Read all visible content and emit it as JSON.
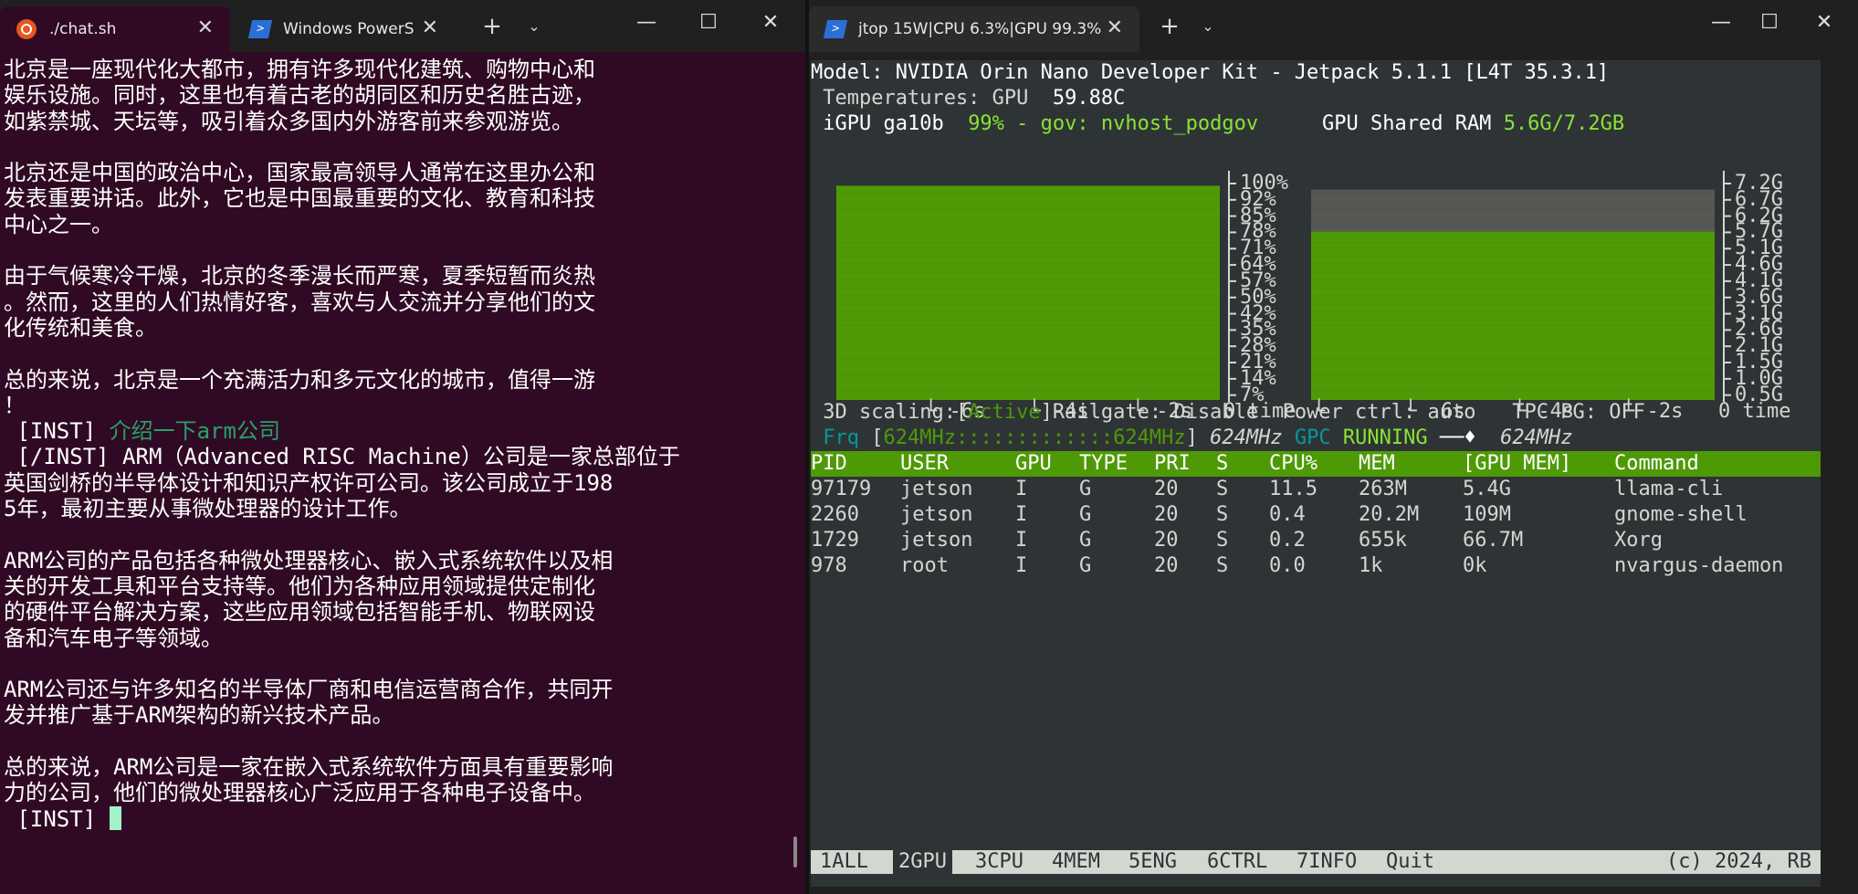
{
  "left_window": {
    "tabs": [
      {
        "label": "./chat.sh",
        "icon": "ubuntu-icon",
        "active": true
      },
      {
        "label": "Windows PowerS",
        "icon": "powershell-icon",
        "active": false
      }
    ],
    "new_tab": "+",
    "dropdown": "⌄",
    "controls": {
      "minimize": "—",
      "maximize": "☐",
      "close": "✕"
    },
    "terminal_lines": [
      {
        "text": "北京是一座现代化大都市，拥有许多现代化建筑、购物中心和"
      },
      {
        "text": "娱乐设施。同时，这里也有着古老的胡同区和历史名胜古迹，"
      },
      {
        "text": "如紫禁城、天坛等，吸引着众多国内外游客前来参观游览。"
      },
      {
        "text": ""
      },
      {
        "text": "北京还是中国的政治中心，国家最高领导人通常在这里办公和"
      },
      {
        "text": "发表重要讲话。此外，它也是中国最重要的文化、教育和科技"
      },
      {
        "text": "中心之一。"
      },
      {
        "text": ""
      },
      {
        "text": "由于气候寒冷干燥，北京的冬季漫长而严寒，夏季短暂而炎热"
      },
      {
        "text": "。然而，这里的人们热情好客，喜欢与人交流并分享他们的文"
      },
      {
        "text": "化传统和美食。"
      },
      {
        "text": ""
      },
      {
        "text": "总的来说，北京是一个充满活力和多元文化的城市，值得一游"
      },
      {
        "text": "！"
      },
      {
        "text": " [INST] ",
        "green": "介绍一下arm公司"
      },
      {
        "text": " [/INST] ARM（Advanced RISC Machine）公司是一家总部位于"
      },
      {
        "text": "英国剑桥的半导体设计和知识产权许可公司。该公司成立于198"
      },
      {
        "text": "5年，最初主要从事微处理器的设计工作。"
      },
      {
        "text": ""
      },
      {
        "text": "ARM公司的产品包括各种微处理器核心、嵌入式系统软件以及相"
      },
      {
        "text": "关的开发工具和平台支持等。他们为各种应用领域提供定制化"
      },
      {
        "text": "的硬件平台解决方案，这些应用领域包括智能手机、物联网设"
      },
      {
        "text": "备和汽车电子等领域。"
      },
      {
        "text": ""
      },
      {
        "text": "ARM公司还与许多知名的半导体厂商和电信运营商合作，共同开"
      },
      {
        "text": "发并推广基于ARM架构的新兴技术产品。"
      },
      {
        "text": ""
      },
      {
        "text": "总的来说，ARM公司是一家在嵌入式系统软件方面具有重要影响"
      },
      {
        "text": "力的公司，他们的微处理器核心广泛应用于各种电子设备中。"
      },
      {
        "text": " [INST] ",
        "cursor": true
      }
    ]
  },
  "right_window": {
    "tabs": [
      {
        "label": "jtop 15W|CPU 6.3%|GPU 99.3%",
        "icon": "powershell-icon",
        "active": true
      }
    ],
    "new_tab": "+",
    "dropdown": "⌄",
    "controls": {
      "minimize": "—",
      "maximize": "☐",
      "close": "✕"
    },
    "jtop": {
      "model_line": "Model: NVIDIA Orin Nano Developer Kit - Jetpack 5.1.1 [L4T 35.3.1]",
      "temp_label": " Temperatures: GPU  ",
      "temp_value": "59.88C",
      "igpu_label": " iGPU ga10b  ",
      "igpu_value": "99% - gov: nvhost_podgov",
      "ram_label": "GPU Shared RAM ",
      "ram_value": "5.6G/7.2GB",
      "gpu_chart_yticks": [
        "100%",
        "92%",
        "85%",
        "78%",
        "71%",
        "64%",
        "57%",
        "50%",
        "42%",
        "35%",
        "28%",
        "21%",
        "14%",
        "7%"
      ],
      "ram_chart_yticks": [
        "7.2G",
        "6.7G",
        "6.2G",
        "5.7G",
        "5.1G",
        "4.6G",
        "4.1G",
        "3.6G",
        "3.1G",
        "2.6G",
        "2.1G",
        "1.5G",
        "1.0G",
        "0.5G"
      ],
      "xticks": [
        "-6s",
        "-4s",
        "-2s"
      ],
      "xtick_zero": "0",
      "xaxis_label": "time",
      "scaling_line": {
        "prefix": " 3D scaling:[",
        "active": "Active",
        "suffix": "]Railgate: Disable  Power ctrl: auto   TPC PG: OFF"
      },
      "frq_line": {
        "frq": " Frq",
        "bracket_open": " [",
        "min": "624MHz",
        "dots": ":::::::::::::",
        "max": "624MHz",
        "bracket_close": "]",
        "cur": " 624MHz ",
        "gpc": "GPC",
        "running": " RUNNING ",
        "arrow": "──♦",
        "gpc_freq": "  624MHz"
      },
      "table": {
        "headers": [
          "PID",
          "USER",
          "GPU",
          "TYPE",
          "PRI",
          "S",
          "CPU%",
          "MEM",
          "[GPU MEM]",
          "Command"
        ],
        "rows": [
          [
            "97179",
            "jetson",
            "I",
            "G",
            "20",
            "S",
            "11.5",
            "263M",
            "5.4G",
            "llama-cli"
          ],
          [
            "2260",
            "jetson",
            "I",
            "G",
            "20",
            "S",
            "0.4",
            "20.2M",
            "109M",
            "gnome-shell"
          ],
          [
            "1729",
            "jetson",
            "I",
            "G",
            "20",
            "S",
            "0.2",
            "655k",
            "66.7M",
            "Xorg"
          ],
          [
            "978",
            "root",
            "I",
            "G",
            "20",
            "S",
            "0.0",
            "1k",
            "0k",
            "nvargus-daemon"
          ]
        ]
      },
      "footer": {
        "items": [
          "1ALL",
          "2GPU",
          "3CPU",
          "4MEM",
          "5ENG",
          "6CTRL",
          "7INFO",
          "Quit"
        ],
        "selected": 1,
        "copyright": "(c) 2024, RB"
      }
    }
  },
  "chart_data": [
    {
      "type": "area",
      "ylabel": "",
      "ylim": [
        0,
        100
      ],
      "yticks": [
        "7%",
        "14%",
        "21%",
        "28%",
        "35%",
        "42%",
        "50%",
        "57%",
        "64%",
        "71%",
        "78%",
        "85%",
        "92%",
        "100%"
      ],
      "xticks": [
        "-6s",
        "-4s",
        "-2s",
        "0"
      ],
      "xlabel": "time",
      "series": [
        {
          "name": "",
          "values": [
            99,
            99,
            99,
            99,
            99,
            99,
            99,
            99
          ],
          "color": "#4e9a06"
        }
      ]
    },
    {
      "type": "area",
      "ylabel": "",
      "ylim": [
        0,
        7.2
      ],
      "yticks": [
        "0.5G",
        "1.0G",
        "1.5G",
        "2.1G",
        "2.6G",
        "3.1G",
        "3.6G",
        "4.1G",
        "4.6G",
        "5.1G",
        "5.7G",
        "6.2G",
        "6.7G",
        "7.2G"
      ],
      "xticks": [
        "-6s",
        "-4s",
        "-2s",
        "0"
      ],
      "xlabel": "time",
      "series": [
        {
          "name": "",
          "values": [
            5.6,
            5.6,
            5.6,
            5.6,
            5.6,
            5.6,
            5.6,
            5.6
          ],
          "color": "#4e9a06"
        },
        {
          "name": "",
          "values": [
            7.0,
            7.0,
            7.0,
            7.0,
            7.0,
            7.0,
            7.0,
            7.0
          ],
          "color": "#555753"
        }
      ]
    }
  ]
}
